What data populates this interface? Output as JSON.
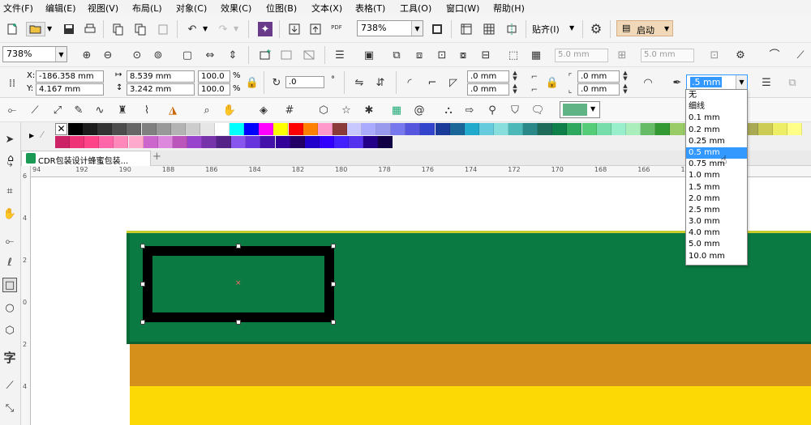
{
  "menu": [
    "文件(F)",
    "编辑(E)",
    "视图(V)",
    "布局(L)",
    "对象(C)",
    "效果(C)",
    "位图(B)",
    "文本(X)",
    "表格(T)",
    "工具(O)",
    "窗口(W)",
    "帮助(H)"
  ],
  "toolbar": {
    "zoom": "738%",
    "snap": "贴齐(I)",
    "launch": "启动",
    "pdf": "PDF"
  },
  "propbar1": {
    "zoom": "738%",
    "w1": "5.0 mm",
    "w2": "5.0 mm"
  },
  "propbar2": {
    "x_label": "X:",
    "x": "-186.358 mm",
    "y_label": "Y:",
    "y": "4.167 mm",
    "w": "8.539 mm",
    "h": "3.242 mm",
    "sx": "100.0",
    "sy": "100.0",
    "pct1": "%",
    "pct2": "%",
    "angle": ".0",
    "deg": "°",
    "corner1": ".0 mm",
    "corner2": ".0 mm",
    "corner3": ".0 mm",
    "corner4": ".0 mm",
    "outline_value": ".5 mm"
  },
  "outline_options": [
    "无",
    "细线",
    "0.1 mm",
    "0.2 mm",
    "0.25 mm",
    "0.5 mm",
    "0.75 mm",
    "1.0 mm",
    "1.5 mm",
    "2.0 mm",
    "2.5 mm",
    "3.0 mm",
    "4.0 mm",
    "5.0 mm",
    "10.0 mm"
  ],
  "outline_selected_index": 5,
  "fill_color": "#5fb384",
  "palette_row1": [
    "#000000",
    "#1c1c1c",
    "#333333",
    "#4d4d4d",
    "#666666",
    "#808080",
    "#999999",
    "#b3b3b3",
    "#cccccc",
    "#e6e6e6",
    "#ffffff",
    "#00ffff",
    "#0000ff",
    "#ff00ff",
    "#ffff00",
    "#ff0000",
    "#ff8000",
    "#ff99cc",
    "#8b3a3a",
    "#c8c8ff",
    "#aaaaff",
    "#9999ee",
    "#7777ee",
    "#5555dd",
    "#3344cc",
    "#1a3a99",
    "#1a6699",
    "#22aacc",
    "#66ccdd",
    "#88dddd",
    "#4db8b8",
    "#2a8888",
    "#1f6b5a",
    "#0f7f4a",
    "#2fa85f",
    "#55cc77",
    "#77ddaa",
    "#99eecc",
    "#aaeebb",
    "#66bb66",
    "#339933",
    "#99cc66",
    "#bbdd88",
    "#dddd99",
    "#999966",
    "#888844",
    "#aaaa55",
    "#cccc55",
    "#eeee66",
    "#ffff88"
  ],
  "palette_row2": [
    "#cc2266",
    "#ee3377",
    "#ff4488",
    "#ff66aa",
    "#ff88bb",
    "#ffaacc",
    "#cc66cc",
    "#dd88dd",
    "#bb55bb",
    "#9944cc",
    "#7733aa",
    "#552288",
    "#8855ee",
    "#6633dd",
    "#4411aa",
    "#330099",
    "#220066",
    "#2200cc",
    "#3300ff",
    "#4422ff",
    "#5533ee",
    "#220088",
    "#110044"
  ],
  "tab": {
    "title": "CDR包装设计蜂蜜包装...",
    "add": "+"
  },
  "ruler": {
    "h": [
      "94",
      "192",
      "190",
      "188",
      "186",
      "184",
      "182",
      "180",
      "178",
      "176",
      "174",
      "172",
      "170",
      "168",
      "166",
      "162",
      "160"
    ],
    "v": [
      "6",
      "4",
      "2",
      "0",
      "2",
      "4"
    ]
  },
  "colors": {
    "green": "#0a7a42",
    "dark_green": "#066b36",
    "orange": "#d4901a",
    "yellow": "#fcd805"
  }
}
